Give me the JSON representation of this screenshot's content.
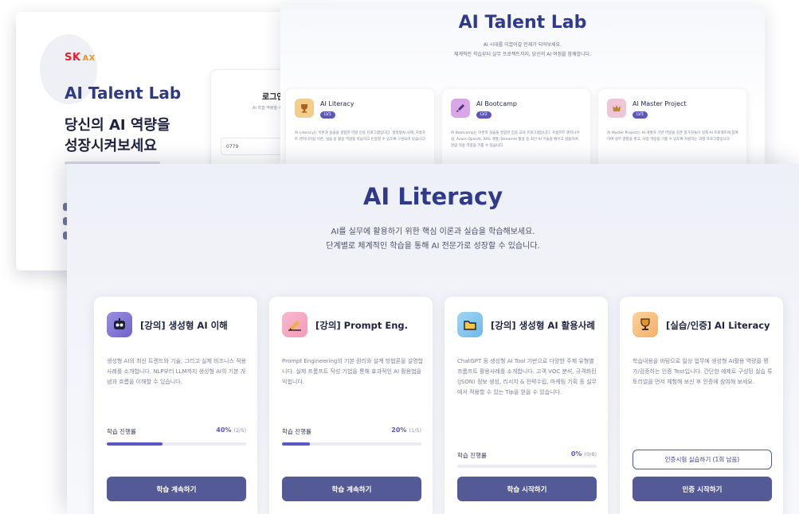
{
  "login": {
    "logo_sk": "SK",
    "logo_ax": "AX",
    "title": "AI Talent Lab",
    "subtitle": "당신의 AI 역량을\n성장시켜보세요",
    "panel_title": "로그인",
    "panel_sub": "AI 학습 역량을 시",
    "id_value": "0779"
  },
  "landing": {
    "title": "AI Talent Lab",
    "line1": "AI 시대를 이끌어갈 인재가 되어보세요.",
    "line2": "체계적인 학습부터 실무 프로젝트까지, 당신의 AI 여정을 함께합니다.",
    "cards": [
      {
        "name": "AI Literacy",
        "badge": "LV1",
        "desc": "AI Literacy는 이론과 실습을 결합한 역량 인증 프로그램입니다. 생성형AI 사례, 프롬프트 엔지니어링 이론, 실습 등 활용 역량을 학습하고 인증할 수 있도록 구성되어 있습니다."
      },
      {
        "name": "AI Bootcamp",
        "badge": "LV2",
        "desc": "AI Bootcamp는 이론과 실습을 결합한 집중 교육 프로그램입니다. 프롬프트 엔지니어링, Azure OpenAI, RAG 개발, Streamlit 활용 등 최신 AI 기술을 배우고 실습하며, 현업 적용 역량을 기를 수 있습니다."
      },
      {
        "name": "AI Master Project",
        "badge": "LV3",
        "desc": "AI Master Project는 AI 개발자 기반 역량을 갖춘 참가자들이 실제 AI 프로젝트에 참여하여 실무 경험을 쌓고, 사업 역량을 기를 수 있도록 지원하는 과정 프로그램입니다."
      }
    ]
  },
  "main": {
    "title": "AI Literacy",
    "line1": "AI를 실무에 활용하기 위한 핵심 이론과 실습을 학습해보세요.",
    "line2": "단계별로 체계적인 학습을 통해 AI 전문가로 성장할 수 있습니다.",
    "progress_label": "학습 진행률",
    "cards": [
      {
        "title": "[강의] 생성형 AI 이해",
        "desc": "생성형 AI의 최신 트렌드와 기술, 그리고 실제 비즈니스 적용사례를 소개합니다. NLP부터 LLM까지 생성형 AI의 기본 개념과 흐름을 이해할 수 있습니다.",
        "progress_pct": "40%",
        "progress_frac": "(2/5)",
        "progress": 0.4,
        "button": "학습 계속하기"
      },
      {
        "title": "[강의] Prompt Eng.",
        "desc": "Prompt Engineering의 기본 원리와 설계 방법론을 설명합니다. 실제 프롬프트 작성 기법을 통해 효과적인 AI 활용법을 익힙니다.",
        "progress_pct": "20%",
        "progress_frac": "(1/5)",
        "progress": 0.2,
        "button": "학습 계속하기"
      },
      {
        "title": "[강의] 생성형 AI 활용사례",
        "desc": "ChatGPT 등 생성형 AI Tool 기반으로 다양한 주제 유형별 프롬프트 활용사례를 소개합니다. 고객 VOC 분석, 규격화된(JSON) 정보 생성, 리서치 & 전략수립, 마케팅 기획 등 실무에서 적용할 수 있는 Tip을 얻을 수 있습니다.",
        "progress_pct": "0%",
        "progress_frac": "(0/8)",
        "progress": 0,
        "button": "학습 시작하기"
      },
      {
        "title": "[실습/인증] AI Literacy",
        "desc": "학습내용을 바탕으로 일상 업무에 생성형 AI활용 역량을 평가/검증하는 인증 Test입니다. 간단한 예제로 구성된 실습 튜토리얼을 먼저 체험해 보신 후 인증에 참여해 보세요.",
        "practice_button": "인증시험 실습하기 (1회 남음)",
        "button": "인증 시작하기"
      }
    ]
  },
  "colors": {
    "brand_navy": "#2f3a8c",
    "button": "#545a95",
    "progress": "#5a58c7",
    "sk_red": "#e5202e"
  },
  "icons": [
    "trophy-icon",
    "rocket-icon",
    "crown-icon",
    "robot-icon",
    "pencil-icon",
    "folder-icon"
  ]
}
